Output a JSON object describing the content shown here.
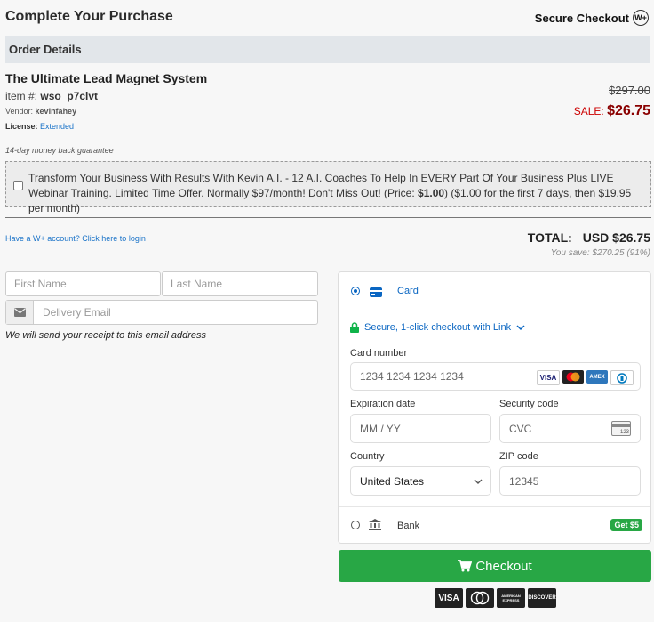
{
  "header": {
    "title": "Complete Your Purchase",
    "secure_label": "Secure Checkout",
    "logo_text": "W+"
  },
  "order": {
    "section_title": "Order Details",
    "product_name": "The Ultimate Lead Magnet System",
    "item_label": "item #:",
    "item_id": "wso_p7clvt",
    "vendor_label": "Vendor:",
    "vendor": "kevinfahey",
    "license_label": "License:",
    "license": "Extended",
    "old_price": "$297.00",
    "sale_label": "SALE:",
    "sale_price": "$26.75",
    "guarantee": "14-day money back guarantee"
  },
  "upsell": {
    "text_before": "Transform Your Business With Results With Kevin A.I. - 12 A.I. Coaches To Help In EVERY Part Of Your Business Plus LIVE Webinar Training. Limited Time Offer. Normally $97/month! Don't Miss Out! (Price: ",
    "price": "$1.00",
    "text_after": ") ($1.00 for the first 7 days, then $19.95 per month)"
  },
  "account": {
    "login_link": "Have a W+ account? Click here to login"
  },
  "totals": {
    "label": "TOTAL:",
    "amount": "USD $26.75",
    "savings": "You save: $270.25 (91%)"
  },
  "form": {
    "first_name_placeholder": "First Name",
    "last_name_placeholder": "Last Name",
    "email_placeholder": "Delivery Email",
    "receipt_note": "We will send your receipt to this email address"
  },
  "payment": {
    "card_label": "Card",
    "link_text": "Secure, 1-click checkout with Link",
    "card_number_label": "Card number",
    "card_number_placeholder": "1234 1234 1234 1234",
    "expiration_label": "Expiration date",
    "expiration_placeholder": "MM / YY",
    "security_label": "Security code",
    "security_placeholder": "CVC",
    "country_label": "Country",
    "country_value": "United States",
    "zip_label": "ZIP code",
    "zip_placeholder": "12345",
    "bank_label": "Bank",
    "bank_badge": "Get $5",
    "card_brands": [
      "VISA",
      "MC",
      "AMEX",
      "DC"
    ],
    "cvc_card_digits": "123"
  },
  "checkout": {
    "label": "Checkout",
    "brand_logos": [
      "VISA",
      "MC",
      "AMERICAN EXPRESS",
      "DISCOVER"
    ]
  },
  "colors": {
    "accent_green": "#28a745",
    "link_blue": "#1a73c8",
    "sale_red": "#8a0000"
  }
}
